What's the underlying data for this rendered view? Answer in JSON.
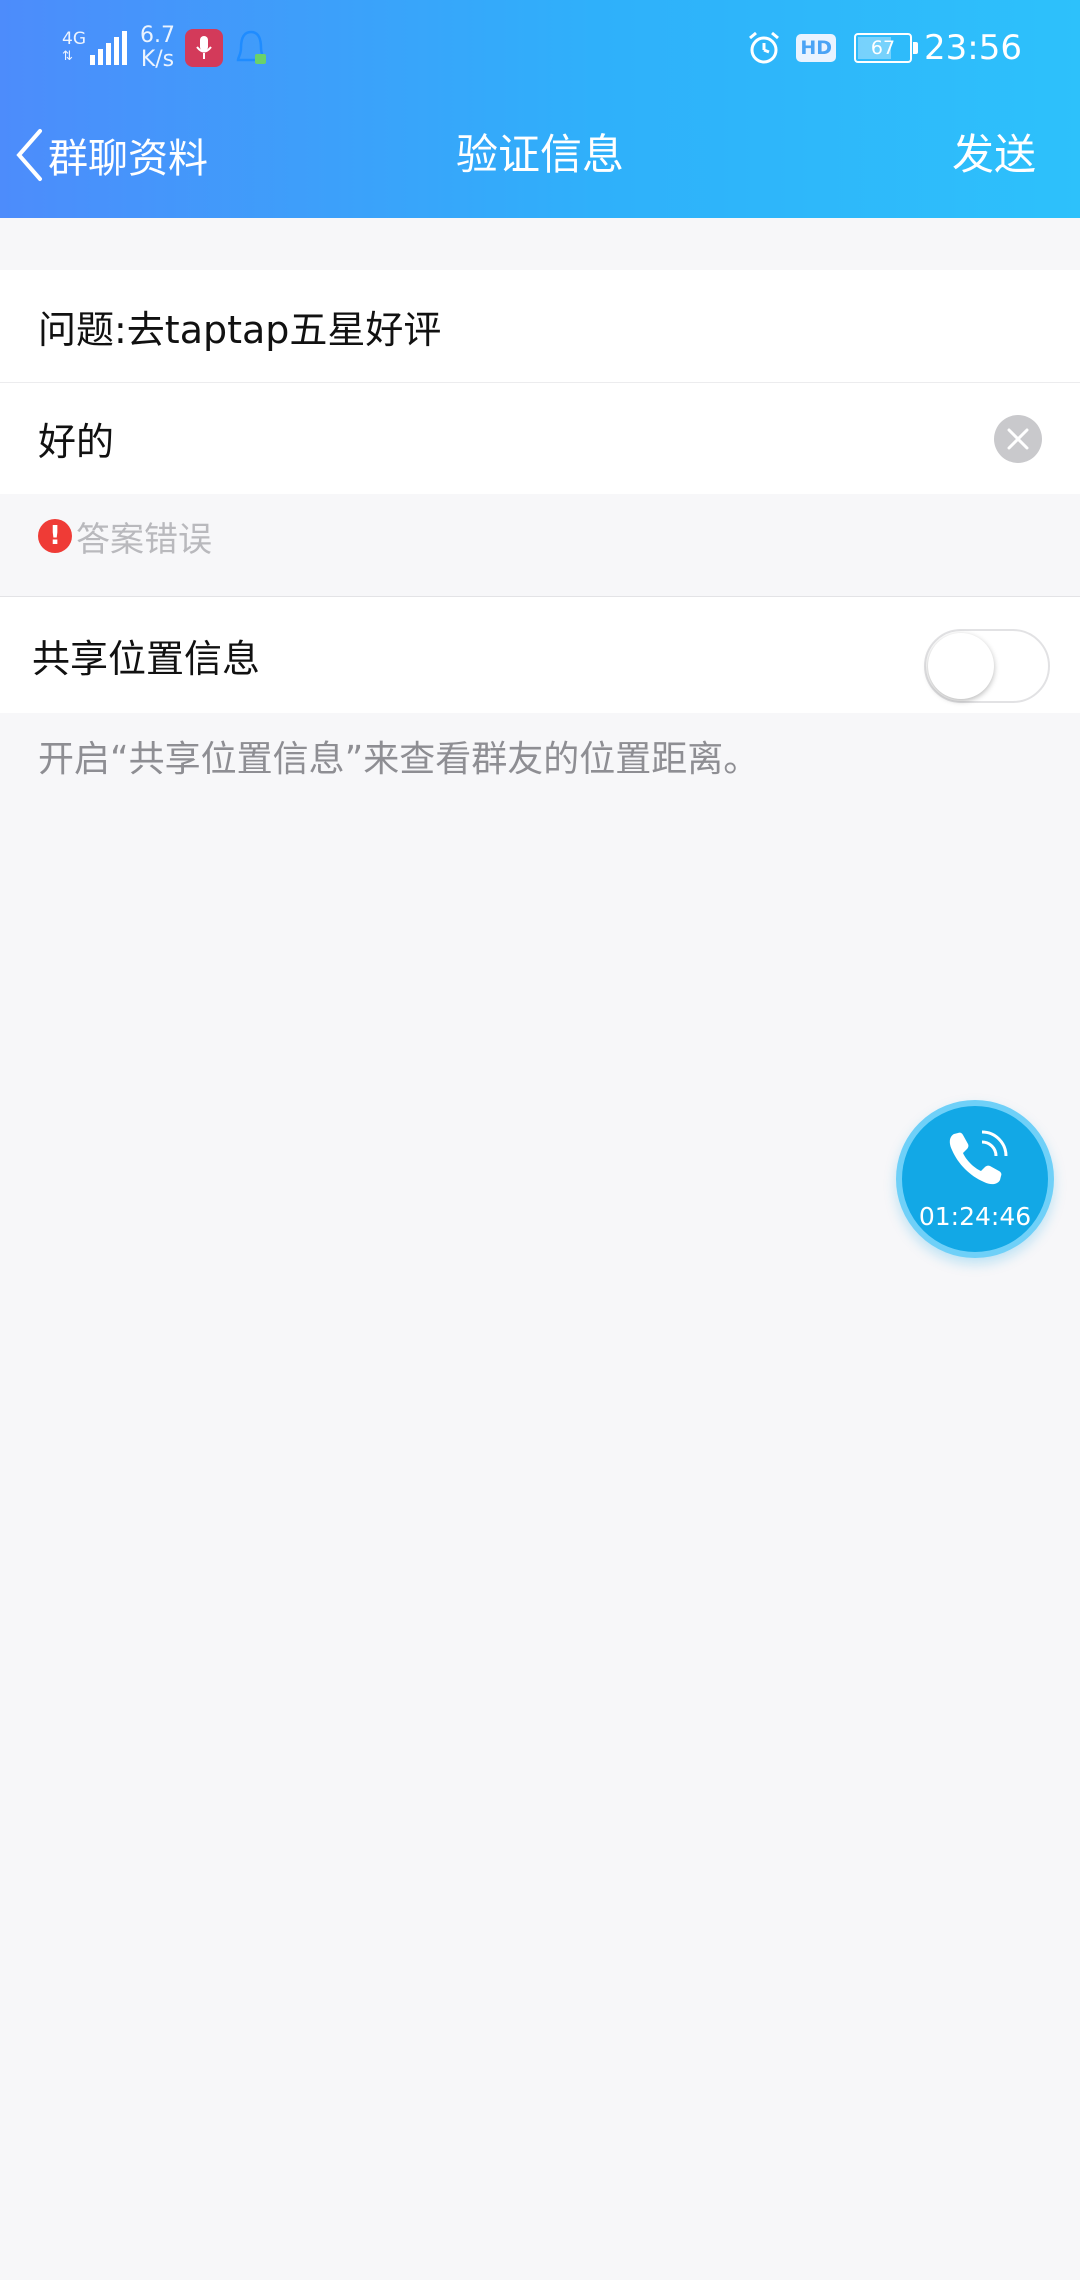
{
  "status_bar": {
    "network_type": "4G",
    "speed_value": "6.7",
    "speed_unit": "K/s",
    "hd_label": "HD",
    "battery_level": "67",
    "clock": "23:56"
  },
  "nav": {
    "back_label": "群聊资料",
    "title": "验证信息",
    "action_label": "发送"
  },
  "form": {
    "question": "问题:去taptap五星好评",
    "answer_value": "好的",
    "error_text": "答案错误"
  },
  "share_location": {
    "label": "共享位置信息",
    "enabled": false,
    "hint": "开启“共享位置信息”来查看群友的位置距离。"
  },
  "call_widget": {
    "duration": "01:24:46"
  },
  "colors": {
    "header_start": "#4d8cfb",
    "header_end": "#2dc1fb",
    "error": "#ef3b36",
    "call_bubble": "#12a8e6"
  }
}
